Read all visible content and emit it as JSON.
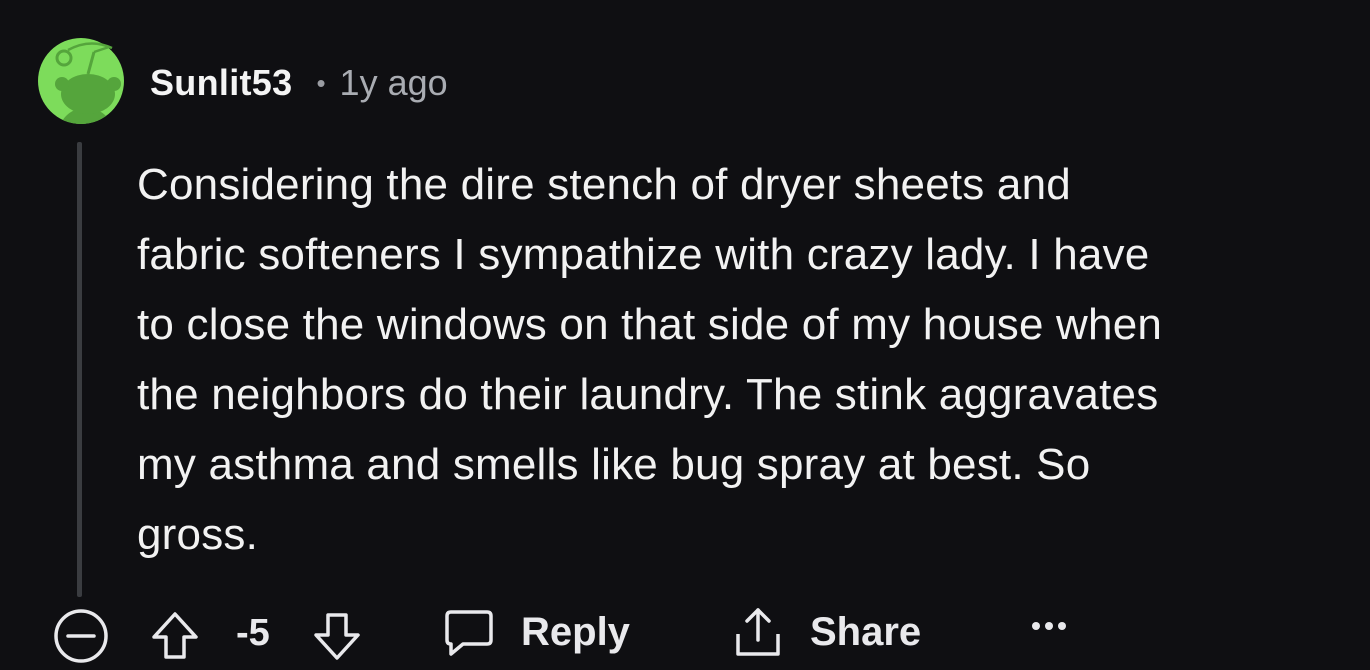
{
  "comment": {
    "username": "Sunlit53",
    "separator": "•",
    "age": "1y ago",
    "body_lines": [
      "Considering the dire stench of dryer sheets and",
      "fabric softeners I sympathize with crazy lady. I have",
      "to close the windows on that side of my house when",
      "the neighbors do their laundry. The stink aggravates",
      "my asthma and smells like bug spray at best. So",
      "gross."
    ]
  },
  "actions": {
    "score": "-5",
    "reply_label": "Reply",
    "share_label": "Share"
  },
  "icons": {
    "collapse": "collapse-minus-icon",
    "upvote": "upvote-arrow-icon",
    "downvote": "downvote-arrow-icon",
    "reply": "speech-bubble-icon",
    "share": "share-upload-icon",
    "more": "more-dots-icon"
  },
  "colors": {
    "background": "#0f0f12",
    "avatar_green": "#7ddc5b",
    "avatar_dark": "#55a53c",
    "text": "#f2f2f2",
    "muted": "#a9acb2"
  }
}
